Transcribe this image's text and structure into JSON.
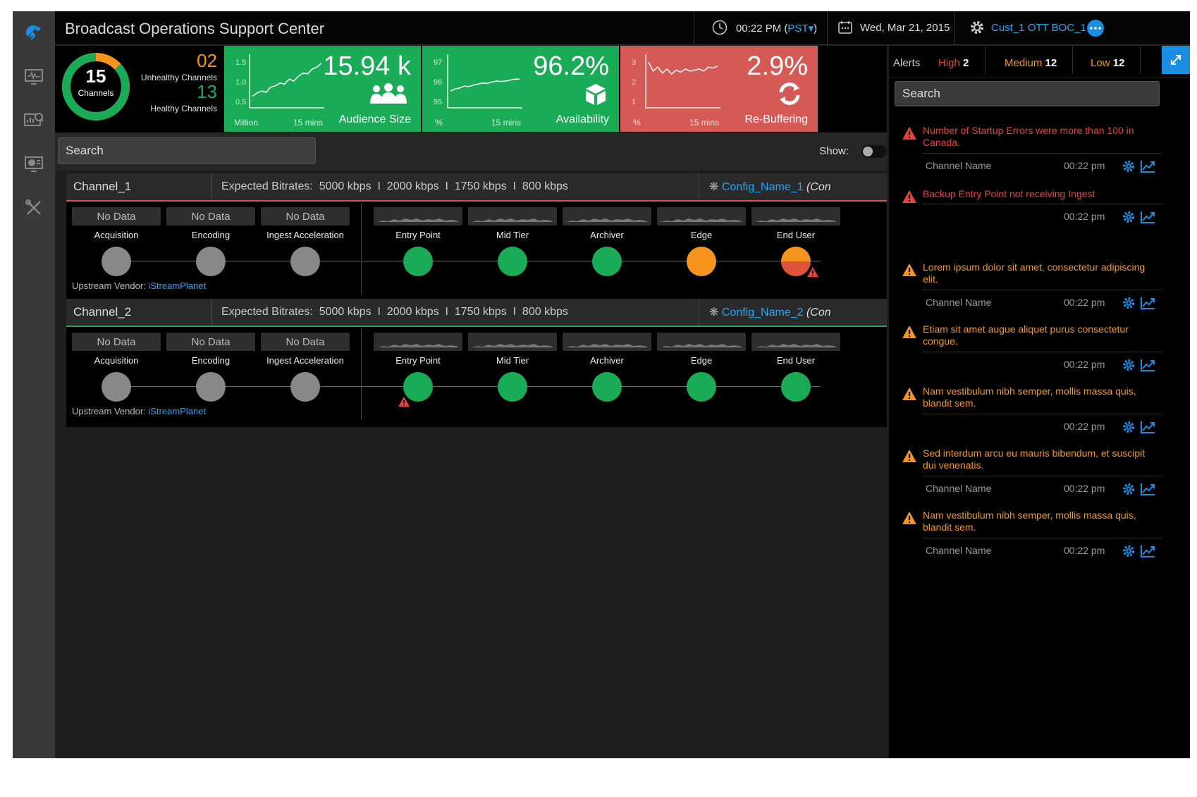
{
  "app": {
    "title": "Broadcast Operations Support Center"
  },
  "topbar": {
    "time": "00:22 PM (",
    "tz": "PST",
    "tz_arrow": "▾",
    "tz_close": ")",
    "date": "Wed, Mar 21, 2015",
    "account": "Cust_1 OTT BOC_1"
  },
  "health": {
    "total": "15",
    "total_label": "Channels",
    "unhealthy": "02",
    "unhealthy_label": "Unhealthy Channels",
    "healthy": "13",
    "healthy_label": "Healthy Channels",
    "healthy_fraction": 0.867
  },
  "kpis": {
    "audience": {
      "value": "15.94 k",
      "caption": "Audience Size",
      "unit": "Million",
      "period": "15 mins",
      "ticks": [
        "1.5",
        "1.0",
        "0.5"
      ],
      "series": [
        0.62,
        0.7,
        0.75,
        0.72,
        0.85,
        0.88,
        0.95,
        0.92,
        1.05,
        1.0,
        1.12,
        1.2,
        1.18,
        1.3,
        1.35,
        1.45
      ]
    },
    "availability": {
      "value": "96.2%",
      "caption": "Availability",
      "unit": "%",
      "period": "15 mins",
      "ticks": [
        "97",
        "96",
        "95"
      ],
      "series": [
        95.5,
        95.6,
        95.65,
        95.75,
        95.72,
        95.8,
        95.85,
        95.9,
        95.88,
        95.95,
        96.0,
        95.98,
        96.0,
        96.05,
        96.1,
        96.1
      ]
    },
    "rebuffering": {
      "value": "2.9%",
      "caption": "Re-Buffering",
      "unit": "%",
      "period": "15 mins",
      "ticks": [
        "3",
        "2",
        "1"
      ],
      "series": [
        2.95,
        2.5,
        2.7,
        2.4,
        2.6,
        2.35,
        2.55,
        2.45,
        2.6,
        2.5,
        2.55,
        2.6,
        2.5,
        2.7,
        2.65,
        2.75
      ]
    },
    "colors": {
      "green": "#1aab56",
      "red": "#d55a55"
    }
  },
  "search": {
    "placeholder": "Search",
    "show_label": "Show:"
  },
  "stage_labels": [
    "Acquisition",
    "Encoding",
    "Ingest Acceleration",
    "Entry Point",
    "Mid Tier",
    "Archiver",
    "Edge",
    "End User"
  ],
  "no_data": "No Data",
  "channels": [
    {
      "name": "Channel_1",
      "rates_label": "Expected Bitrates:",
      "rates": "5000 kbps  I  2000 kbps  I  1750 kbps  I  800 kbps",
      "config": "Config_Name_1",
      "config_suffix": "(Con",
      "vendor_label": "Upstream Vendor:",
      "vendor": "iStreamPlanet",
      "status_color": "#d9534f",
      "stage_status": [
        "gray",
        "gray",
        "gray",
        "green",
        "green",
        "green",
        "orange",
        "orange-red"
      ],
      "warn_at": "End User"
    },
    {
      "name": "Channel_2",
      "rates_label": "Expected Bitrates:",
      "rates": "5000 kbps  I  2000 kbps  I  1750 kbps  I  800 kbps",
      "config": "Config_Name_2",
      "config_suffix": "(Con",
      "vendor_label": "Upstream Vendor:",
      "vendor": "iStreamPlanet",
      "status_color": "#1aab56",
      "stage_status": [
        "gray",
        "gray",
        "gray",
        "green",
        "green",
        "green",
        "green",
        "green"
      ],
      "warn_at": "Entry Point"
    }
  ],
  "status_colors": {
    "gray": "#888888",
    "green": "#1aab56",
    "orange": "#f7941d",
    "red": "#e0533d"
  },
  "alerts": {
    "title": "Alerts",
    "high_label": "High",
    "high_count": "2",
    "medium_label": "Medium",
    "medium_count": "12",
    "low_label": "Low",
    "low_count": "12",
    "search_placeholder": "Search",
    "items": [
      {
        "level": "high",
        "message": "Number of Startup Errors were more than 100 in Canada.",
        "channel": "Channel Name",
        "time": "00:22 pm"
      },
      {
        "level": "high",
        "message": "Backup Entry Point not receiving Ingest",
        "channel": "",
        "time": "00:22 pm"
      },
      {
        "level": "medium",
        "message": "Lorem ipsum dolor sit amet, consectetur adipiscing elit.",
        "channel": "Channel Name",
        "time": "00:22 pm"
      },
      {
        "level": "medium",
        "message": "Etiam sit amet augue aliquet purus consectetur congue.",
        "channel": "",
        "time": "00:22 pm"
      },
      {
        "level": "medium",
        "message": "Nam vestibulum nibh semper, mollis massa quis, blandit sem.",
        "channel": "",
        "time": "00:22 pm"
      },
      {
        "level": "medium",
        "message": "Sed interdum arcu eu mauris bibendum, et suscipit dui venenatis.",
        "channel": "Channel Name",
        "time": "00:22 pm"
      },
      {
        "level": "medium",
        "message": "Nam vestibulum nibh semper, mollis massa quis, blandit sem.",
        "channel": "Channel Name",
        "time": "00:22 pm"
      }
    ],
    "colors": {
      "high": "#e8423c",
      "medium": "#f7941d",
      "accent": "#1b8ee2"
    }
  }
}
